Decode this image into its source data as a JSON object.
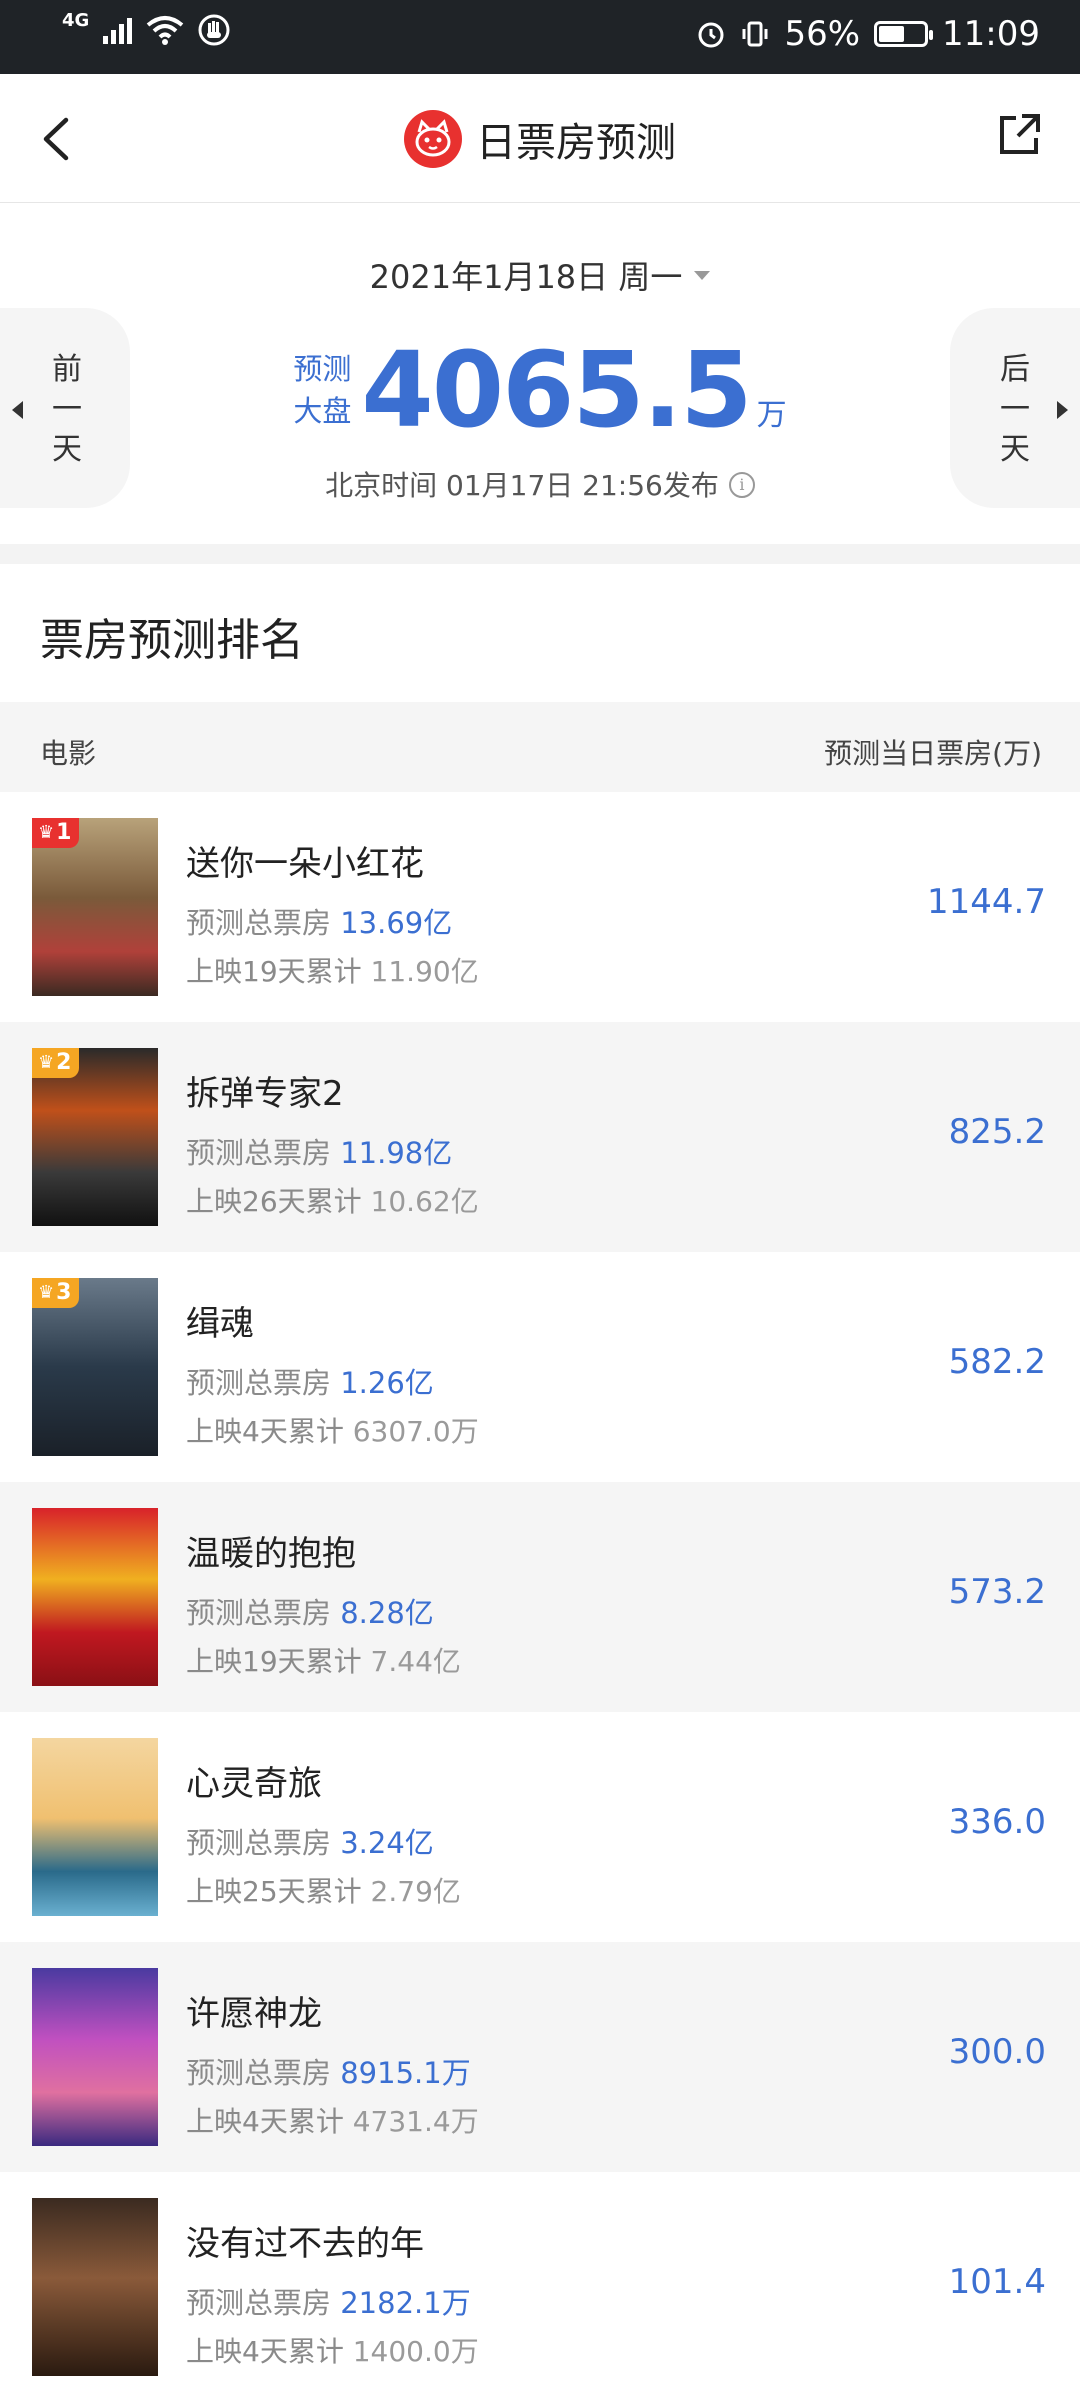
{
  "status_bar": {
    "network": "4G",
    "battery_percent": "56%",
    "battery_level": 0.56,
    "time": "11:09"
  },
  "nav": {
    "title": "日票房预测"
  },
  "header": {
    "date": "2021年1月18日 周一",
    "prev_label": [
      "前",
      "一",
      "天"
    ],
    "next_label": [
      "后",
      "一",
      "天"
    ],
    "forecast_label_1": "预测",
    "forecast_label_2": "大盘",
    "forecast_value": "4065.5",
    "forecast_unit": "万",
    "publish_text": "北京时间 01月17日 21:56发布"
  },
  "section": {
    "title": "票房预测排名",
    "col_movie": "电影",
    "col_forecast": "预测当日票房(万)"
  },
  "colors": {
    "accent_blue": "#3b6fd1",
    "rank_1": "#e8312f",
    "rank_2": "#f5a623",
    "rank_3": "#f5a623"
  },
  "movies": [
    {
      "rank": "1",
      "name": "送你一朵小红花",
      "total_label": "预测总票房",
      "total": "13.69亿",
      "cum_label": "上映19天累计",
      "cum": "11.90亿",
      "forecast": "1144.7",
      "poster_bg": "linear-gradient(180deg,#b8a27a 0%,#7a5a3a 45%,#b0413a 75%,#3b2a22 100%)"
    },
    {
      "rank": "2",
      "name": "拆弹专家2",
      "total_label": "预测总票房",
      "total": "11.98亿",
      "cum_label": "上映26天累计",
      "cum": "10.62亿",
      "forecast": "825.2",
      "poster_bg": "linear-gradient(180deg,#2a2a2a 0%,#c0501a 35%,#3a3a3a 70%,#111 100%)"
    },
    {
      "rank": "3",
      "name": "缉魂",
      "total_label": "预测总票房",
      "total": "1.26亿",
      "cum_label": "上映4天累计",
      "cum": "6307.0万",
      "forecast": "582.2",
      "poster_bg": "linear-gradient(180deg,#6a7a8a 0%,#2a3a4a 50%,#1a2028 100%)"
    },
    {
      "rank": "",
      "name": "温暖的抱抱",
      "total_label": "预测总票房",
      "total": "8.28亿",
      "cum_label": "上映19天累计",
      "cum": "7.44亿",
      "forecast": "573.2",
      "poster_bg": "linear-gradient(180deg,#d8222a 0%,#f0b020 40%,#c01820 70%,#8a1015 100%)"
    },
    {
      "rank": "",
      "name": "心灵奇旅",
      "total_label": "预测总票房",
      "total": "3.24亿",
      "cum_label": "上映25天累计",
      "cum": "2.79亿",
      "forecast": "336.0",
      "poster_bg": "linear-gradient(180deg,#f4d6a0 0%,#f0c070 45%,#2a6a8a 75%,#6ab0d0 100%)"
    },
    {
      "rank": "",
      "name": "许愿神龙",
      "total_label": "预测总票房",
      "total": "8915.1万",
      "cum_label": "上映4天累计",
      "cum": "4731.4万",
      "forecast": "300.0",
      "poster_bg": "linear-gradient(180deg,#4a3aa0 0%,#c050c0 40%,#e070a0 70%,#3a2a80 100%)"
    },
    {
      "rank": "",
      "name": "没有过不去的年",
      "total_label": "预测总票房",
      "total": "2182.1万",
      "cum_label": "上映4天累计",
      "cum": "1400.0万",
      "forecast": "101.4",
      "poster_bg": "linear-gradient(180deg,#3a2a20 0%,#8a5a3a 45%,#2a1a10 100%)"
    }
  ]
}
